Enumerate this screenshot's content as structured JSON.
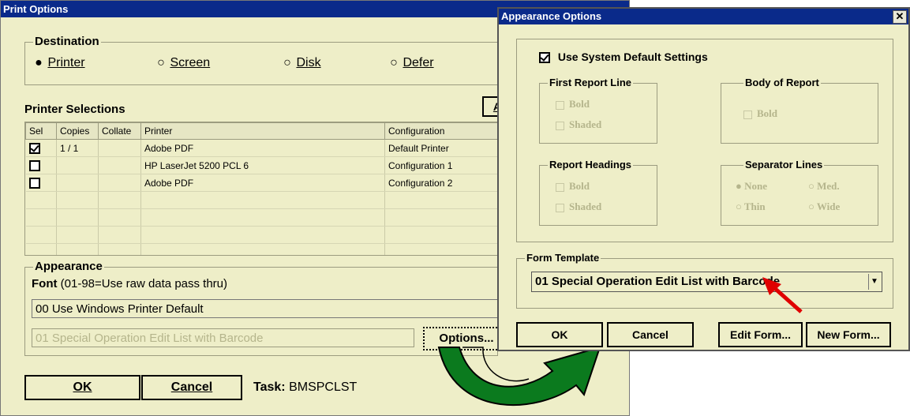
{
  "print_options": {
    "title": "Print Options",
    "destination": {
      "label": "Destination",
      "options": [
        {
          "label": "Printer",
          "selected": true
        },
        {
          "label": "Screen",
          "selected": false
        },
        {
          "label": "Disk",
          "selected": false
        },
        {
          "label": "Defer",
          "selected": false
        }
      ]
    },
    "printer_selections_label": "Printer Selections",
    "partial_button_label": "A",
    "table": {
      "headers": [
        "Sel",
        "Copies",
        "Collate",
        "Printer",
        "Configuration"
      ],
      "rows": [
        {
          "sel": true,
          "copies": "1 / 1",
          "collate": "",
          "printer": "Adobe PDF",
          "configuration": "Default Printer"
        },
        {
          "sel": false,
          "copies": "",
          "collate": "",
          "printer": "HP LaserJet 5200 PCL 6",
          "configuration": "Configuration 1"
        },
        {
          "sel": false,
          "copies": "",
          "collate": "",
          "printer": "Adobe PDF",
          "configuration": "Configuration 2"
        }
      ]
    },
    "appearance": {
      "label": "Appearance",
      "font_label": "Font",
      "font_hint": " (01-98=Use raw data pass thru)",
      "font_value": "00 Use Windows Printer Default",
      "template_value": "01 Special Operation Edit List with Barcode",
      "options_button": "Options..."
    },
    "ok_label": "OK",
    "cancel_label": "Cancel",
    "task_label": "Task:",
    "task_value": "BMSPCLST"
  },
  "appearance_options": {
    "title": "Appearance Options",
    "close_glyph": "✕",
    "use_system_default": {
      "label": "Use System Default Settings",
      "checked": true
    },
    "first_report_line": {
      "label": "First Report Line",
      "bold": "Bold",
      "shaded": "Shaded"
    },
    "body_of_report": {
      "label": "Body of Report",
      "bold": "Bold"
    },
    "report_headings": {
      "label": "Report Headings",
      "bold": "Bold",
      "shaded": "Shaded"
    },
    "separator_lines": {
      "label": "Separator Lines",
      "none": "None",
      "med": "Med.",
      "thin": "Thin",
      "wide": "Wide",
      "selected": "None"
    },
    "form_template": {
      "label": "Form Template",
      "value": "01 Special Operation Edit List with Barcode"
    },
    "ok_label": "OK",
    "cancel_label": "Cancel",
    "edit_form_label": "Edit Form...",
    "new_form_label": "New Form..."
  },
  "colors": {
    "window_bg": "#EEEEC8",
    "titlebar": "#0A2A8A",
    "arrow_green": "#0B7A1E",
    "pointer_red": "#E00000"
  }
}
